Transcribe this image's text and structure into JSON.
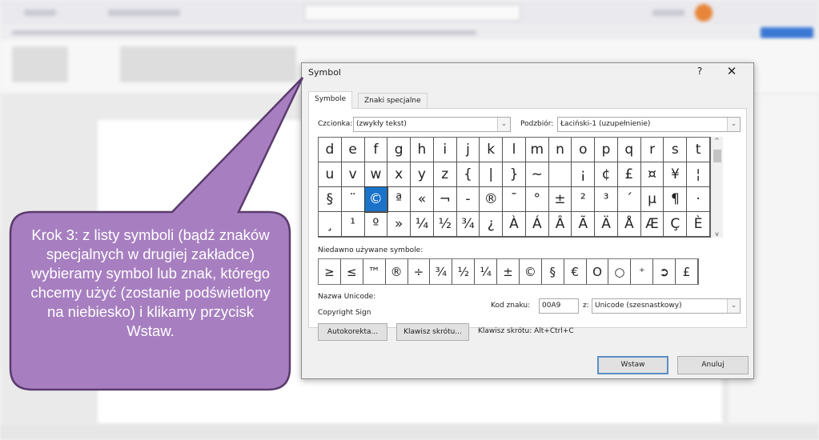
{
  "dialog": {
    "title": "Symbol",
    "help_label": "?",
    "close_label": "✕",
    "tabs": [
      "Symbole",
      "Znaki specjalne"
    ],
    "font_label": "Czcionka:",
    "font_value": "(zwykły tekst)",
    "subset_label": "Podzbiór:",
    "subset_value": "Łaciński-1 (uzupełnienie)",
    "grid": [
      [
        "d",
        "e",
        "f",
        "g",
        "h",
        "i",
        "j",
        "k",
        "l",
        "m",
        "n",
        "o",
        "p",
        "q",
        "r",
        "s",
        "t"
      ],
      [
        "u",
        "v",
        "w",
        "x",
        "y",
        "z",
        "{",
        "|",
        "}",
        "~",
        "",
        "¡",
        "¢",
        "£",
        "¤",
        "¥",
        "¦"
      ],
      [
        "§",
        "¨",
        "©",
        "ª",
        "«",
        "¬",
        "-",
        "®",
        "¯",
        "°",
        "±",
        "²",
        "³",
        "´",
        "µ",
        "¶",
        "·"
      ],
      [
        "¸",
        "¹",
        "º",
        "»",
        "¼",
        "½",
        "¾",
        "¿",
        "À",
        "Á",
        "Â",
        "Ã",
        "Ä",
        "Å",
        "Æ",
        "Ç",
        "È"
      ]
    ],
    "selected_symbol": "©",
    "recent_label": "Niedawno używane symbole:",
    "recent": [
      "≥",
      "≤",
      "™",
      "®",
      "÷",
      "¾",
      "½",
      "¼",
      "±",
      "©",
      "§",
      "€",
      "O",
      "○",
      "⁺",
      "➲",
      "£"
    ],
    "unicode_name_label": "Nazwa Unicode:",
    "unicode_name": "Copyright Sign",
    "code_label": "Kod znaku:",
    "code_value": "00A9",
    "from_label": "z:",
    "from_value": "Unicode (szesnastkowy)",
    "autocorrect_button": "Autokorekta...",
    "shortcut_button": "Klawisz skrótu...",
    "shortcut_text": "Klawisz skrótu: Alt+Ctrl+C",
    "insert_button": "Wstaw",
    "cancel_button": "Anuluj",
    "accent_color": "#1a73c9"
  },
  "callout": {
    "text": "Krok 3: z listy symboli (bądź znaków specjalnych w drugiej zakładce) wybieramy symbol lub znak, którego chcemy użyć (zostanie podświetlony na niebiesko) i klikamy przycisk Wstaw.",
    "fill_color": "#a77fc0",
    "border_color": "#5b3b6e"
  }
}
